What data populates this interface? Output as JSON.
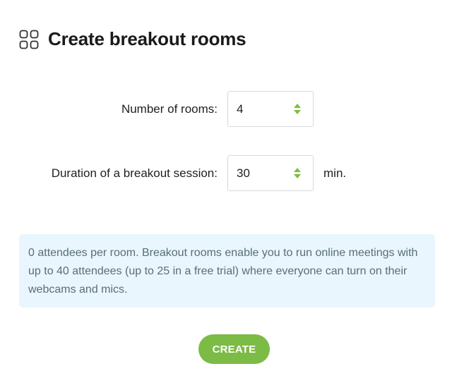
{
  "dialog": {
    "title": "Create breakout rooms",
    "icon": "grid-rooms-icon"
  },
  "form": {
    "rooms": {
      "label": "Number of rooms:",
      "value": "4"
    },
    "duration": {
      "label": "Duration of a breakout session:",
      "value": "30",
      "unit": "min."
    }
  },
  "info": {
    "text": "0 attendees per room. Breakout rooms enable you to run online meetings with up to 40 attendees (up to 25 in a free trial) where everyone can turn on their webcams and mics."
  },
  "actions": {
    "create_label": "CREATE"
  },
  "colors": {
    "accent": "#7cbb45",
    "info_background": "#e9f6fd",
    "info_text": "#5a6d7a"
  }
}
